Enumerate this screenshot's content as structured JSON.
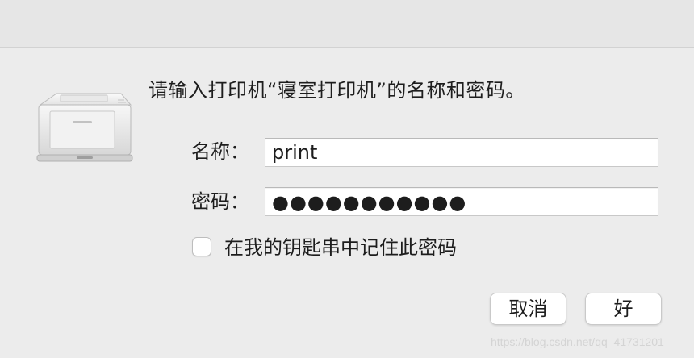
{
  "dialog": {
    "prompt": "请输入打印机“寝室打印机”的名称和密码。",
    "fields": {
      "name_label": "名称：",
      "name_value": "print",
      "password_label": "密码：",
      "password_value": "●●●●●●●●●●●"
    },
    "remember": {
      "label": "在我的钥匙串中记住此密码",
      "checked": false
    },
    "buttons": {
      "cancel": "取消",
      "ok": "好"
    },
    "icon": "printer-icon"
  },
  "watermark": "https://blog.csdn.net/qq_41731201"
}
